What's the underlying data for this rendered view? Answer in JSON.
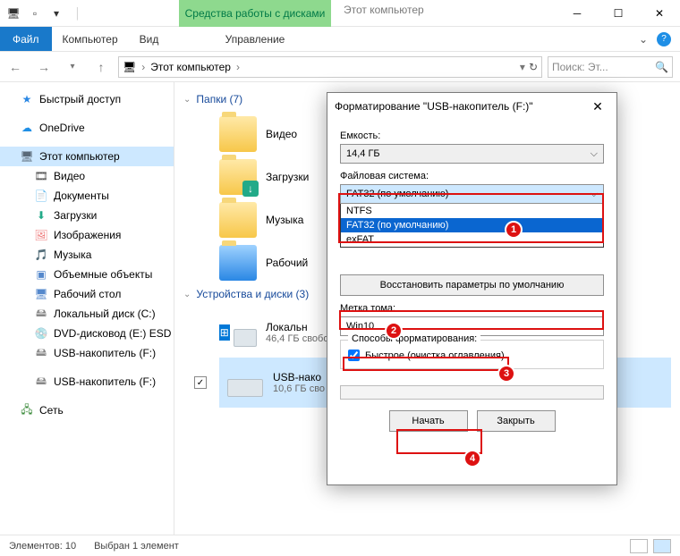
{
  "titlebar": {
    "app_title": "Этот компьютер"
  },
  "ribbon": {
    "file": "Файл",
    "tabs": [
      "Компьютер",
      "Вид"
    ],
    "context_top": "Средства работы с дисками",
    "context_bottom": "Управление"
  },
  "addr": {
    "crumb": "Этот компьютер",
    "search_placeholder": "Поиск: Эт..."
  },
  "sidebar": {
    "quick": "Быстрый доступ",
    "onedrive": "OneDrive",
    "thispc": "Этот компьютер",
    "items": [
      {
        "icon": "🎞",
        "label": "Видео"
      },
      {
        "icon": "📄",
        "label": "Документы"
      },
      {
        "icon": "⬇",
        "label": "Загрузки"
      },
      {
        "icon": "🖼",
        "label": "Изображения"
      },
      {
        "icon": "🎵",
        "label": "Музыка"
      },
      {
        "icon": "▣",
        "label": "Объемные объекты"
      },
      {
        "icon": "🖥",
        "label": "Рабочий стол"
      },
      {
        "icon": "🖴",
        "label": "Локальный диск (C:)"
      },
      {
        "icon": "💿",
        "label": "DVD-дисковод (E:) ESD"
      },
      {
        "icon": "🖴",
        "label": "USB-накопитель (F:)"
      },
      {
        "icon": "🖴",
        "label": "USB-накопитель (F:)"
      }
    ],
    "network": "Сеть"
  },
  "content": {
    "group_folders": "Папки (7)",
    "folders": [
      "Видео",
      "Загрузки",
      "Музыка",
      "Рабочий"
    ],
    "group_devices": "Устройства и диски (3)",
    "devices": [
      {
        "name": "Локальн",
        "sub": "46,4 ГБ свобод",
        "win": true
      },
      {
        "name": "USB-нако",
        "sub": "10,6 ГБ сво",
        "sel": true
      }
    ]
  },
  "dialog": {
    "title": "Форматирование \"USB-накопитель (F:)\"",
    "capacity_label": "Емкость:",
    "capacity_value": "14,4 ГБ",
    "fs_label": "Файловая система:",
    "fs_value": "FAT32 (по умолчанию)",
    "fs_options": [
      "NTFS",
      "FAT32 (по умолчанию)",
      "exFAT"
    ],
    "restore_btn": "Восстановить параметры по умолчанию",
    "volume_label": "Метка тома:",
    "volume_value": "Win10",
    "methods_label": "Способы форматирования:",
    "quick_label": "Быстрое (очистка оглавления)",
    "start_btn": "Начать",
    "close_btn": "Закрыть"
  },
  "status": {
    "count": "Элементов: 10",
    "sel": "Выбран 1 элемент"
  },
  "callouts": [
    "1",
    "2",
    "3",
    "4"
  ]
}
